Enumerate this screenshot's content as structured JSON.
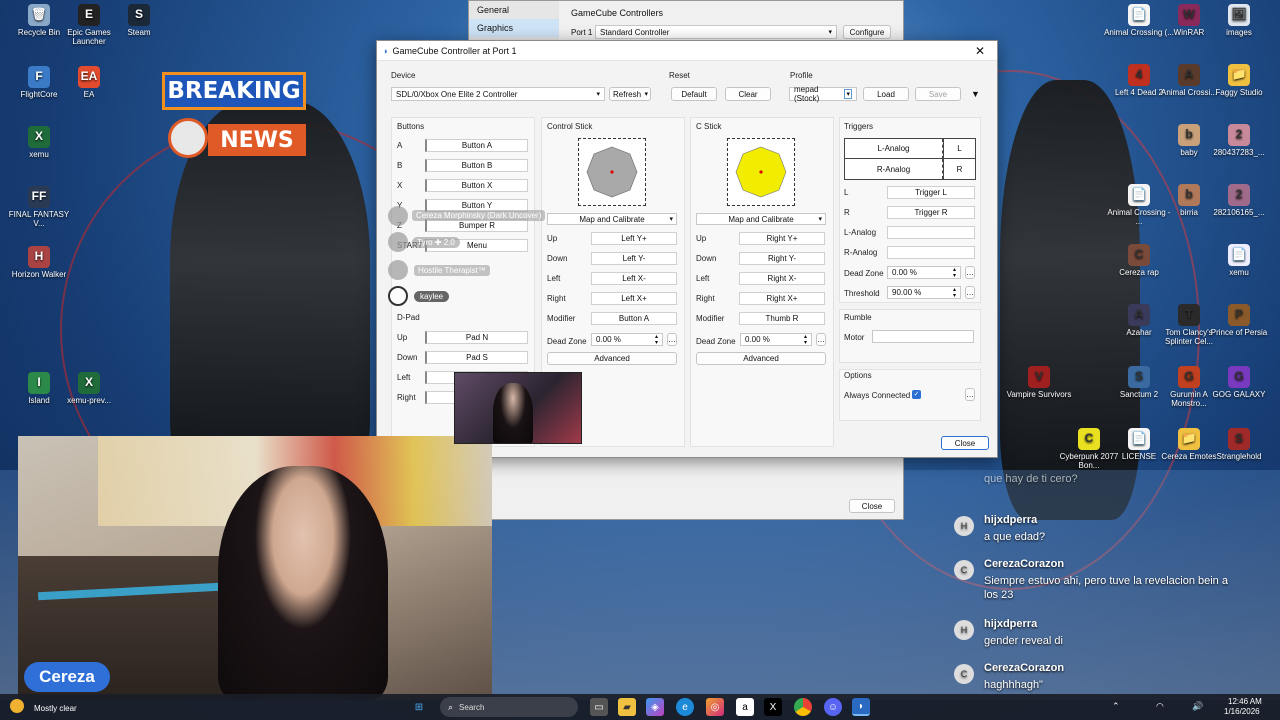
{
  "desktop_icons_left": [
    {
      "label": "Recycle Bin",
      "color": "#8aa9c8",
      "glyph": "🗑"
    },
    {
      "label": "Epic Games Launcher",
      "color": "#222",
      "glyph": "E"
    },
    {
      "label": "Steam",
      "color": "#1b2838",
      "glyph": "S"
    },
    {
      "label": "FlightCore",
      "color": "#3a7ac7",
      "glyph": "F"
    },
    {
      "label": "EA",
      "color": "#e24b2d",
      "glyph": "EA"
    },
    {
      "label": "xemu",
      "color": "#1f6b3a",
      "glyph": "X"
    },
    {
      "label": "FINAL FANTASY V...",
      "color": "#2a3a55",
      "glyph": "FF"
    },
    {
      "label": "Horizon Walker",
      "color": "#a44",
      "glyph": "H"
    },
    {
      "label": "Island",
      "color": "#2b8a4a",
      "glyph": "I"
    },
    {
      "label": "xemu-prev...",
      "color": "#1f6b3a",
      "glyph": "X"
    }
  ],
  "desktop_icons_right": [
    {
      "label": "Animal Crossing (...",
      "color": "#f5f5f5",
      "glyph": "📄"
    },
    {
      "label": "WinRAR",
      "color": "#8a2a5a",
      "glyph": "W"
    },
    {
      "label": "images",
      "color": "#dfe6ee",
      "glyph": "🖼"
    },
    {
      "label": "Left 4 Dead 2",
      "color": "#c03020",
      "glyph": "4"
    },
    {
      "label": "Animal Crossi...",
      "color": "#5a3a2a",
      "glyph": "A"
    },
    {
      "label": "Faggy Studio",
      "color": "#f0c040",
      "glyph": "📁"
    },
    {
      "label": "baby",
      "color": "#c8a07a",
      "glyph": "b"
    },
    {
      "label": "280437283_...",
      "color": "#c88a9a",
      "glyph": "2"
    },
    {
      "label": "Animal Crossing - ...",
      "color": "#f5f5f5",
      "glyph": "📄"
    },
    {
      "label": "birria",
      "color": "#b07a5a",
      "glyph": "b"
    },
    {
      "label": "282106165_...",
      "color": "#a06a8a",
      "glyph": "2"
    },
    {
      "label": "Cereza rap",
      "color": "#7a4a3a",
      "glyph": "C"
    },
    {
      "label": "xemu",
      "color": "#eef",
      "glyph": "📄"
    },
    {
      "label": "Azahar",
      "color": "#3a3a5a",
      "glyph": "A"
    },
    {
      "label": "Tom Clancy's Splinter Cel...",
      "color": "#2a2a2a",
      "glyph": "T"
    },
    {
      "label": "Prince of Persia",
      "color": "#8a5a2a",
      "glyph": "P"
    },
    {
      "label": "Vampire Survivors",
      "color": "#a02020",
      "glyph": "V"
    },
    {
      "label": "Sanctum 2",
      "color": "#3a6aa0",
      "glyph": "S"
    },
    {
      "label": "Gurumin A Monstro...",
      "color": "#c04020",
      "glyph": "G"
    },
    {
      "label": "GOG GALAXY",
      "color": "#7a3ac0",
      "glyph": "G"
    },
    {
      "label": "Cyberpunk 2077 Bon...",
      "color": "#e8e020",
      "glyph": "C"
    },
    {
      "label": "LICENSE",
      "color": "#f5f5f5",
      "glyph": "📄"
    },
    {
      "label": "Cereza Emotes",
      "color": "#f0c040",
      "glyph": "📁"
    },
    {
      "label": "Stranglehold",
      "color": "#a02a2a",
      "glyph": "S"
    }
  ],
  "breaking_news": {
    "line1": "BREAKING",
    "line2": "NEWS"
  },
  "bg_window": {
    "nav": [
      "General",
      "Graphics"
    ],
    "section": "GameCube Controllers",
    "port_label": "Port 1",
    "port_value": "Standard Controller",
    "configure": "Configure",
    "close": "Close"
  },
  "dialog": {
    "title": "GameCube Controller at Port 1",
    "device": {
      "label": "Device",
      "value": "SDL/0/Xbox One Elite 2 Controller",
      "refresh": "Refresh"
    },
    "reset": {
      "label": "Reset",
      "default": "Default",
      "clear": "Clear"
    },
    "profile": {
      "label": "Profile",
      "value": "mepad (Stock)",
      "load": "Load",
      "save": "Save"
    },
    "buttons": {
      "title": "Buttons",
      "rows": [
        {
          "key": "A",
          "value": "Button A"
        },
        {
          "key": "B",
          "value": "Button B"
        },
        {
          "key": "X",
          "value": "Button X"
        },
        {
          "key": "Y",
          "value": "Button Y"
        },
        {
          "key": "Z",
          "value": "Bumper R"
        },
        {
          "key": "START",
          "value": "Menu"
        }
      ]
    },
    "dpad": {
      "title": "D-Pad",
      "rows": [
        {
          "key": "Up",
          "value": "Pad N"
        },
        {
          "key": "Down",
          "value": "Pad S"
        },
        {
          "key": "Left",
          "value": ""
        },
        {
          "key": "Right",
          "value": ""
        }
      ]
    },
    "control_stick": {
      "title": "Control Stick",
      "map": "Map and Calibrate",
      "rows": [
        {
          "key": "Up",
          "value": "Left Y+"
        },
        {
          "key": "Down",
          "value": "Left Y-"
        },
        {
          "key": "Left",
          "value": "Left X-"
        },
        {
          "key": "Right",
          "value": "Left X+"
        },
        {
          "key": "Modifier",
          "value": "Button A"
        }
      ],
      "deadzone_label": "Dead Zone",
      "deadzone": "0.00 %",
      "advanced": "Advanced",
      "octagon_color": "#a9a9a9"
    },
    "c_stick": {
      "title": "C Stick",
      "map": "Map and Calibrate",
      "rows": [
        {
          "key": "Up",
          "value": "Right Y+"
        },
        {
          "key": "Down",
          "value": "Right Y-"
        },
        {
          "key": "Left",
          "value": "Right X-"
        },
        {
          "key": "Right",
          "value": "Right X+"
        },
        {
          "key": "Modifier",
          "value": "Thumb R"
        }
      ],
      "deadzone_label": "Dead Zone",
      "deadzone": "0.00 %",
      "advanced": "Advanced",
      "octagon_color": "#f2ec00"
    },
    "triggers": {
      "title": "Triggers",
      "l_analog": "L-Analog",
      "r_analog": "R-Analog",
      "l_short": "L",
      "r_short": "R",
      "rows": [
        {
          "key": "L",
          "value": "Trigger L"
        },
        {
          "key": "R",
          "value": "Trigger R"
        },
        {
          "key": "L-Analog",
          "value": ""
        },
        {
          "key": "R-Analog",
          "value": ""
        }
      ],
      "deadzone_label": "Dead Zone",
      "deadzone": "0.00 %",
      "threshold_label": "Threshold",
      "threshold": "90.00 %"
    },
    "rumble": {
      "title": "Rumble",
      "motor": "Motor"
    },
    "options": {
      "title": "Options",
      "always_connected": "Always Connected"
    },
    "close": "Close"
  },
  "overlay_names": [
    "Cereza Morphinsky (Dark Uncover)",
    "Hostile Therapist™",
    "kaylee"
  ],
  "overlay_tags": [
    "Tyro ✚ 2.0"
  ],
  "streamer_name": "Cereza",
  "chat": [
    {
      "name": "",
      "text": "que hay de ti cero?",
      "avatar": ""
    },
    {
      "name": "hijxdperra",
      "text": "a que edad?",
      "avatar": "H"
    },
    {
      "name": "CerezaCorazon",
      "text": "Siempre estuvo ahi, pero tuve la revelacion bein a los 23",
      "avatar": "C"
    },
    {
      "name": "hijxdperra",
      "text": "gender reveal di",
      "avatar": "H"
    },
    {
      "name": "CerezaCorazon",
      "text": "haghhhagh\"",
      "avatar": "C"
    }
  ],
  "taskbar": {
    "weather": "Mostly clear",
    "search": "Search",
    "time": "12:46 AM",
    "date": "1/16/2026"
  }
}
